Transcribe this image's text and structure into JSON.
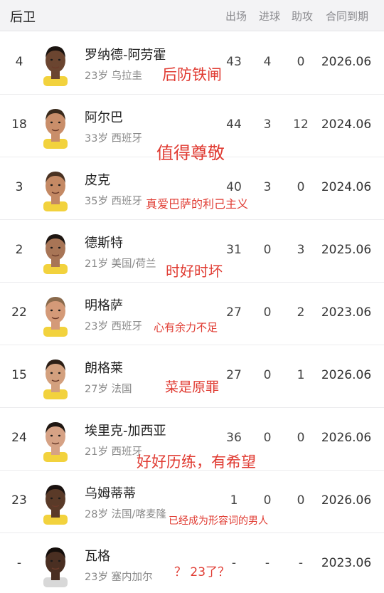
{
  "header": {
    "title": "后卫",
    "columns": [
      "出场",
      "进球",
      "助攻",
      "合同到期"
    ]
  },
  "players": [
    {
      "number": "4",
      "name": "罗纳德-阿劳霍",
      "info": "23岁 乌拉圭",
      "apps": "43",
      "goals": "4",
      "assists": "0",
      "contract": "2026.06",
      "note": "后防铁闸",
      "skin": "#6b4530",
      "hair": "#1b1410",
      "shirt": "#f2d23d"
    },
    {
      "number": "18",
      "name": "阿尔巴",
      "info": "33岁 西班牙",
      "apps": "44",
      "goals": "3",
      "assists": "12",
      "contract": "2024.06",
      "note": "值得尊敬",
      "skin": "#c98e6a",
      "hair": "#3a2a1c",
      "shirt": "#f2d23d"
    },
    {
      "number": "3",
      "name": "皮克",
      "info": "35岁 西班牙",
      "apps": "40",
      "goals": "3",
      "assists": "0",
      "contract": "2024.06",
      "note": "真爱巴萨的利己主义",
      "skin": "#c48964",
      "hair": "#4a3222",
      "shirt": "#f2d23d"
    },
    {
      "number": "2",
      "name": "德斯特",
      "info": "21岁 美国/荷兰",
      "apps": "31",
      "goals": "0",
      "assists": "3",
      "contract": "2025.06",
      "note": "时好时坏",
      "skin": "#a87556",
      "hair": "#1e1612",
      "shirt": "#f2d23d"
    },
    {
      "number": "22",
      "name": "明格萨",
      "info": "23岁 西班牙",
      "apps": "27",
      "goals": "0",
      "assists": "2",
      "contract": "2023.06",
      "note": "心有余力不足",
      "skin": "#d49a78",
      "hair": "#8a6a4c",
      "shirt": "#f2d23d"
    },
    {
      "number": "15",
      "name": "朗格莱",
      "info": "27岁 法国",
      "apps": "27",
      "goals": "0",
      "assists": "1",
      "contract": "2026.06",
      "note": "菜是原罪",
      "skin": "#d3a07e",
      "hair": "#2c1f16",
      "shirt": "#f2d23d"
    },
    {
      "number": "24",
      "name": "埃里克-加西亚",
      "info": "21岁 西班牙",
      "apps": "36",
      "goals": "0",
      "assists": "0",
      "contract": "2026.06",
      "note": "好好历练，有希望",
      "skin": "#d6a285",
      "hair": "#1f1712",
      "shirt": "#f2d23d"
    },
    {
      "number": "23",
      "name": "乌姆蒂蒂",
      "info": "28岁 法国/喀麦隆",
      "apps": "1",
      "goals": "0",
      "assists": "0",
      "contract": "2026.06",
      "note": "已经成为形容词的男人",
      "skin": "#5a3a28",
      "hair": "#1a1210",
      "shirt": "#f2d23d"
    },
    {
      "number": "-",
      "name": "瓦格",
      "info": "23岁 塞内加尔",
      "apps": "-",
      "goals": "-",
      "assists": "-",
      "contract": "2023.06",
      "note": "？ 23了？",
      "skin": "#4a2f22",
      "hair": "#140e0b",
      "shirt": "#d8d8d8"
    }
  ]
}
